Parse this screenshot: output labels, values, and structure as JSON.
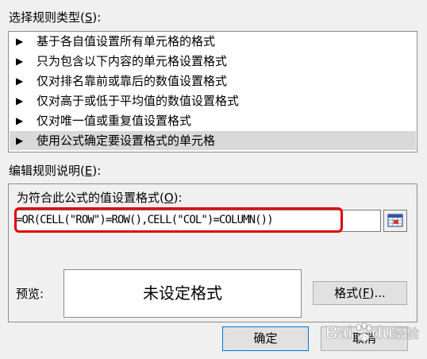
{
  "rule_type": {
    "label": "选择规则类型(",
    "accel": "S",
    "label_end": "):",
    "items": [
      {
        "label": "基于各自值设置所有单元格的格式",
        "selected": false
      },
      {
        "label": "只为包含以下内容的单元格设置格式",
        "selected": false
      },
      {
        "label": "仅对排名靠前或靠后的数值设置格式",
        "selected": false
      },
      {
        "label": "仅对高于或低于平均值的数值设置格式",
        "selected": false
      },
      {
        "label": "仅对唯一值或重复值设置格式",
        "selected": false
      },
      {
        "label": "使用公式确定要设置格式的单元格",
        "selected": true
      }
    ],
    "arrow_glyph": "▶"
  },
  "description": {
    "label": "编辑规则说明(",
    "accel": "E",
    "label_end": "):",
    "formula_label": "为符合此公式的值设置格式(",
    "formula_accel": "O",
    "formula_label_end": "):",
    "formula_value": "=OR(CELL(\"ROW\")=ROW(),CELL(\"COL\")=COLUMN())",
    "ref_button_icon": "range-select-icon",
    "preview_label": "预览:",
    "preview_text": "未设定格式",
    "format_button": "格式(",
    "format_accel": "F",
    "format_button_end": ")..."
  },
  "footer": {
    "ok_button": "确定",
    "cancel_button": "取消"
  },
  "watermark": {
    "text": "Baidu经验",
    "icon": "baidu-paw-icon"
  },
  "colors": {
    "highlight": "#e00000",
    "selected_row": "#d9d9d9",
    "ok_border": "#0078d7"
  }
}
